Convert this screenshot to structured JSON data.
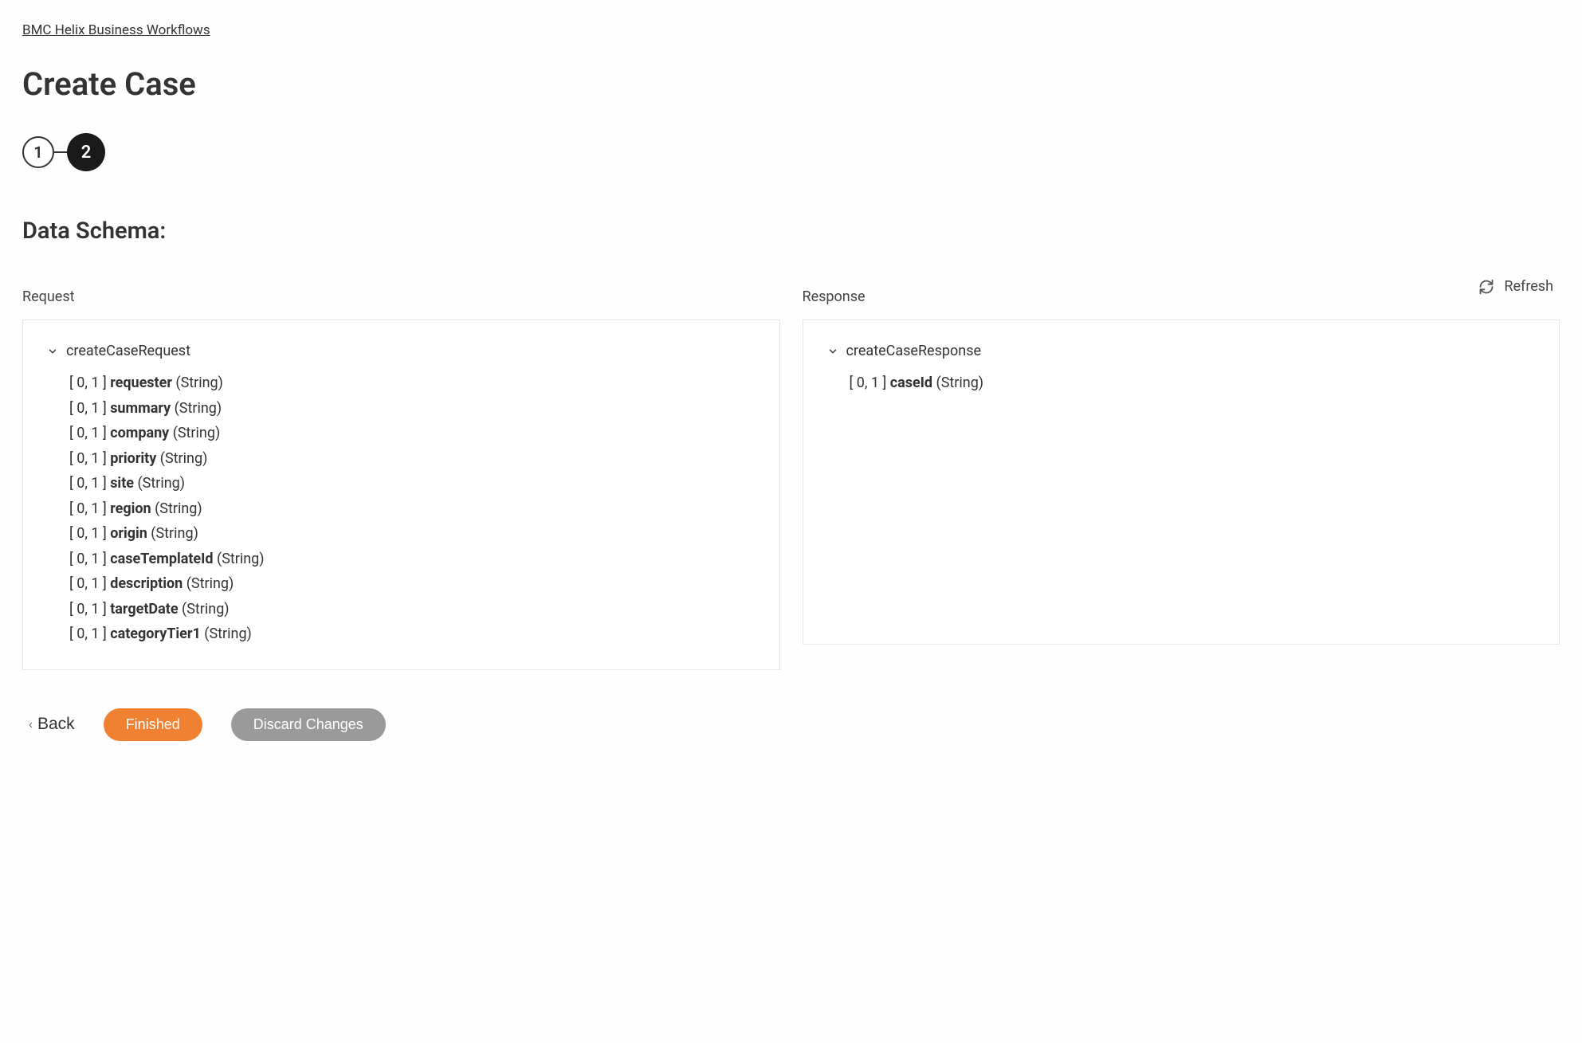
{
  "breadcrumb": "BMC Helix Business Workflows",
  "title": "Create Case",
  "stepper": {
    "step1": "1",
    "step2": "2"
  },
  "section_title": "Data Schema:",
  "refresh_label": "Refresh",
  "request": {
    "label": "Request",
    "root": "createCaseRequest",
    "fields": [
      {
        "card": "[ 0, 1 ]",
        "name": "requester",
        "type": "(String)"
      },
      {
        "card": "[ 0, 1 ]",
        "name": "summary",
        "type": "(String)"
      },
      {
        "card": "[ 0, 1 ]",
        "name": "company",
        "type": "(String)"
      },
      {
        "card": "[ 0, 1 ]",
        "name": "priority",
        "type": "(String)"
      },
      {
        "card": "[ 0, 1 ]",
        "name": "site",
        "type": "(String)"
      },
      {
        "card": "[ 0, 1 ]",
        "name": "region",
        "type": "(String)"
      },
      {
        "card": "[ 0, 1 ]",
        "name": "origin",
        "type": "(String)"
      },
      {
        "card": "[ 0, 1 ]",
        "name": "caseTemplateId",
        "type": "(String)"
      },
      {
        "card": "[ 0, 1 ]",
        "name": "description",
        "type": "(String)"
      },
      {
        "card": "[ 0, 1 ]",
        "name": "targetDate",
        "type": "(String)"
      },
      {
        "card": "[ 0, 1 ]",
        "name": "categoryTier1",
        "type": "(String)"
      }
    ]
  },
  "response": {
    "label": "Response",
    "root": "createCaseResponse",
    "fields": [
      {
        "card": "[ 0, 1 ]",
        "name": "caseId",
        "type": "(String)"
      }
    ]
  },
  "footer": {
    "back": "Back",
    "finished": "Finished",
    "discard": "Discard Changes"
  }
}
